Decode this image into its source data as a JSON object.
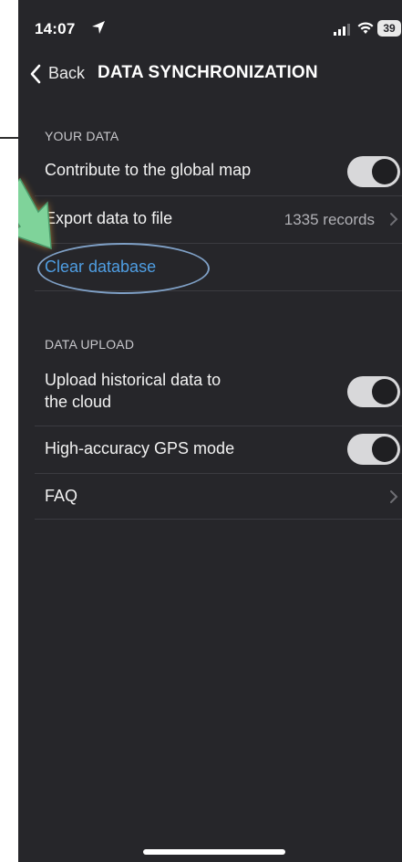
{
  "status_bar": {
    "time": "14:07",
    "battery": "39"
  },
  "nav": {
    "back_label": "Back",
    "title": "DATA SYNCHRONIZATION"
  },
  "sections": [
    {
      "header": "YOUR DATA",
      "rows": [
        {
          "label": "Contribute to the global map",
          "toggle": true
        },
        {
          "label": "Export data to file",
          "detail": "1335 records"
        },
        {
          "label": "Clear database",
          "accent": "#4f9ee3"
        }
      ]
    },
    {
      "header": "DATA UPLOAD",
      "rows": [
        {
          "label": "Upload historical data to",
          "label_line2": "the cloud",
          "toggle": true
        },
        {
          "label": "High-accuracy GPS mode",
          "toggle": true
        },
        {
          "label": "FAQ"
        }
      ]
    }
  ],
  "colors": {
    "background": "#26262a",
    "accent": "#4f9ee3",
    "callout_arrow": "#7fd39a",
    "callout_glow": "#f0a23a"
  }
}
